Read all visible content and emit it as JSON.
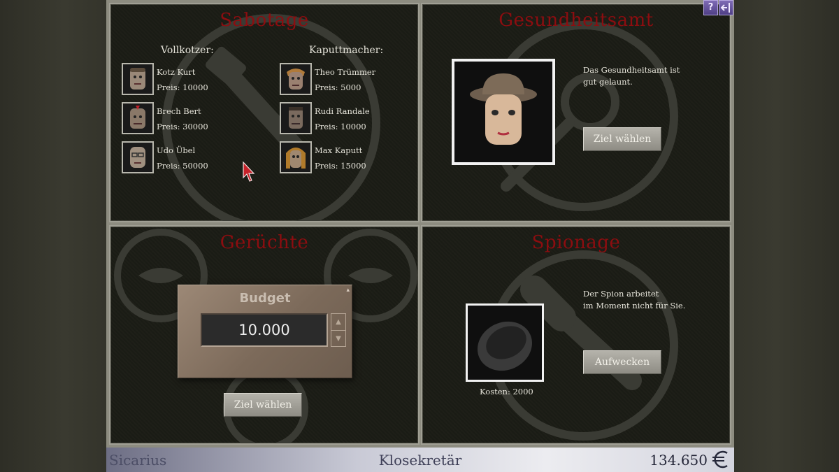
{
  "sabotage": {
    "title": "Sabotage",
    "left_header": "Vollkotzer:",
    "right_header": "Kaputtmacher:",
    "left_mercs": [
      {
        "name": "Kotz Kurt",
        "price": "Preis: 10000"
      },
      {
        "name": "Brech Bert",
        "price": "Preis: 30000"
      },
      {
        "name": "Udo Übel",
        "price": "Preis: 50000"
      }
    ],
    "right_mercs": [
      {
        "name": "Theo Trümmer",
        "price": "Preis: 5000"
      },
      {
        "name": "Rudi Randale",
        "price": "Preis: 10000"
      },
      {
        "name": "Max Kaputt",
        "price": "Preis: 15000"
      }
    ]
  },
  "health": {
    "title": "Gesundheitsamt",
    "status_line1": "Das Gesundheitsamt ist",
    "status_line2": "gut gelaunt.",
    "button": "Ziel wählen"
  },
  "rumors": {
    "title": "Gerüchte",
    "budget_label": "Budget",
    "budget_value": "10.000",
    "button": "Ziel wählen"
  },
  "spy": {
    "title": "Spionage",
    "status_line1": "Der Spion arbeitet",
    "status_line2": "im Moment nicht für Sie.",
    "cost": "Kosten: 2000",
    "button": "Aufwecken"
  },
  "statusbar": {
    "player": "Sicarius",
    "rank": "Klosekretär",
    "money": "134.650"
  },
  "corner": {
    "help": "?"
  },
  "colors": {
    "panel_bg": "#1b1c15",
    "title_red": "#8c0d10",
    "frame": "#8d8c80"
  }
}
